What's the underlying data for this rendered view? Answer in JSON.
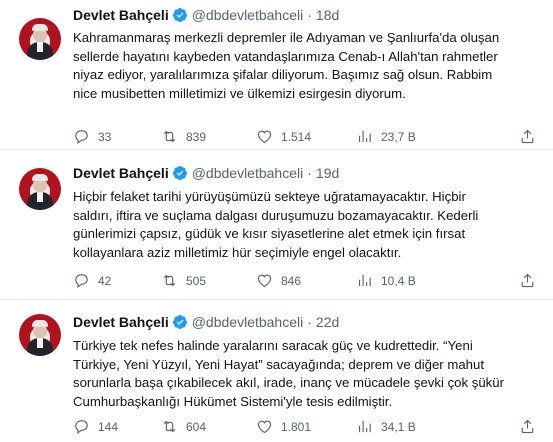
{
  "tweets": [
    {
      "author": "Devlet Bahçeli",
      "handle": "@dbdevletbahceli",
      "separator": "·",
      "time": "18d",
      "lines": [
        "Kahramanmaraş merkezli depremler ile Adıyaman ve Şanlıurfa'da oluşan",
        "sellerde hayatını kaybeden vatandaşlarımıza Cenab-ı Allah'tan rahmetler",
        "niyaz ediyor, yaralılarımıza şifalar diliyorum. Başımız sağ olsun. Rabbim",
        "nice musibetten milletimizi ve ülkemizi esirgesin diyorum."
      ],
      "replies": "33",
      "retweets": "839",
      "likes": "1.514",
      "views": "23,7 B"
    },
    {
      "author": "Devlet Bahçeli",
      "handle": "@dbdevletbahceli",
      "separator": "·",
      "time": "19d",
      "lines": [
        "Hiçbir felaket tarihi yürüyüşümüzü sekteye uğratamayacaktır. Hiçbir",
        "saldırı, iftira ve suçlama dalgası duruşumuzu bozamayacaktır. Kederli",
        "günlerimizi çapsız, güdük ve kısır siyasetlerine alet etmek için fırsat",
        "kollayanlara aziz milletimiz hür seçimiyle engel olacaktır."
      ],
      "replies": "42",
      "retweets": "505",
      "likes": "846",
      "views": "10,4 B"
    },
    {
      "author": "Devlet Bahçeli",
      "handle": "@dbdevletbahceli",
      "separator": "·",
      "time": "22d",
      "lines": [
        "Türkiye tek nefes halinde yaralarını saracak güç ve kudrettedir. “Yeni",
        "Türkiye, Yeni Yüzyıl, Yeni Hayat” sacayağında; deprem ve diğer mahut",
        "sorunlarla başa çıkabilecek akıl, irade, inanç ve mücadele şevki çok şükür",
        "Cumhurbaşkanlığı Hükümet Sistemi'yle tesis edilmiştir."
      ],
      "replies": "144",
      "retweets": "604",
      "likes": "1.801",
      "views": "34,1 B"
    }
  ],
  "colors": {
    "verified": "#1d9bf0",
    "muted": "#536471",
    "text": "#0f1419",
    "avatar_bg": "#b1121f"
  }
}
